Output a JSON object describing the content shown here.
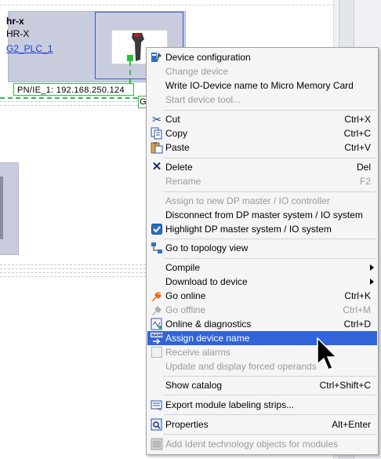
{
  "device": {
    "name": "hr-x",
    "type": "HR-X",
    "controller_link": "G2_PLC_1",
    "network_label": "PN/IE_1:  192.168.250.124",
    "network_tag": "G"
  },
  "context_menu": {
    "items": [
      {
        "label": "Device configuration",
        "icon": "device-configuration-icon",
        "enabled": true
      },
      {
        "label": "Change device",
        "enabled": false
      },
      {
        "label": "Write IO-Device name to Micro Memory Card",
        "enabled": true
      },
      {
        "label": "Start device tool...",
        "enabled": false
      },
      {
        "label": "Cut",
        "shortcut": "Ctrl+X",
        "icon": "scissors-icon",
        "enabled": true
      },
      {
        "label": "Copy",
        "shortcut": "Ctrl+C",
        "icon": "copy-icon",
        "enabled": true
      },
      {
        "label": "Paste",
        "shortcut": "Ctrl+V",
        "icon": "paste-icon",
        "enabled": true
      },
      {
        "label": "Delete",
        "shortcut": "Del",
        "icon": "delete-x-icon",
        "enabled": true
      },
      {
        "label": "Rename",
        "shortcut": "F2",
        "enabled": false
      },
      {
        "label": "Assign to new DP master / IO controller",
        "enabled": false
      },
      {
        "label": "Disconnect from DP master system / IO system",
        "enabled": true
      },
      {
        "label": "Highlight DP master system / IO system",
        "icon": "highlight-checkbox-icon",
        "enabled": true
      },
      {
        "label": "Go to topology view",
        "icon": "topology-view-icon",
        "enabled": true
      },
      {
        "label": "Compile",
        "submenu": true,
        "enabled": true
      },
      {
        "label": "Download to device",
        "submenu": true,
        "enabled": true
      },
      {
        "label": "Go online",
        "shortcut": "Ctrl+K",
        "icon": "go-online-icon",
        "enabled": true
      },
      {
        "label": "Go offline",
        "shortcut": "Ctrl+M",
        "icon": "go-offline-icon",
        "enabled": false
      },
      {
        "label": "Online & diagnostics",
        "shortcut": "Ctrl+D",
        "icon": "online-diagnostics-icon",
        "enabled": true
      },
      {
        "label": "Assign device name",
        "icon": "assign-name-icon",
        "enabled": true,
        "highlighted": true
      },
      {
        "label": "Receive alarms",
        "icon": "receive-alarms-icon",
        "enabled": false
      },
      {
        "label": "Update and display forced operands",
        "enabled": false
      },
      {
        "label": "Show catalog",
        "shortcut": "Ctrl+Shift+C",
        "enabled": true
      },
      {
        "label": "Export module labeling strips...",
        "icon": "export-labels-icon",
        "enabled": true
      },
      {
        "label": "Properties",
        "shortcut": "Alt+Enter",
        "icon": "properties-icon",
        "enabled": true
      },
      {
        "label": "Add Ident technology objects for modules",
        "icon": "ident-objects-icon",
        "enabled": false
      }
    ]
  },
  "colors": {
    "highlight": "#3064d8",
    "device_fill": "#c9ccdd",
    "network_green": "#26c438",
    "link_blue": "#1a3fd0",
    "disabled_text": "#9a9a9a"
  }
}
